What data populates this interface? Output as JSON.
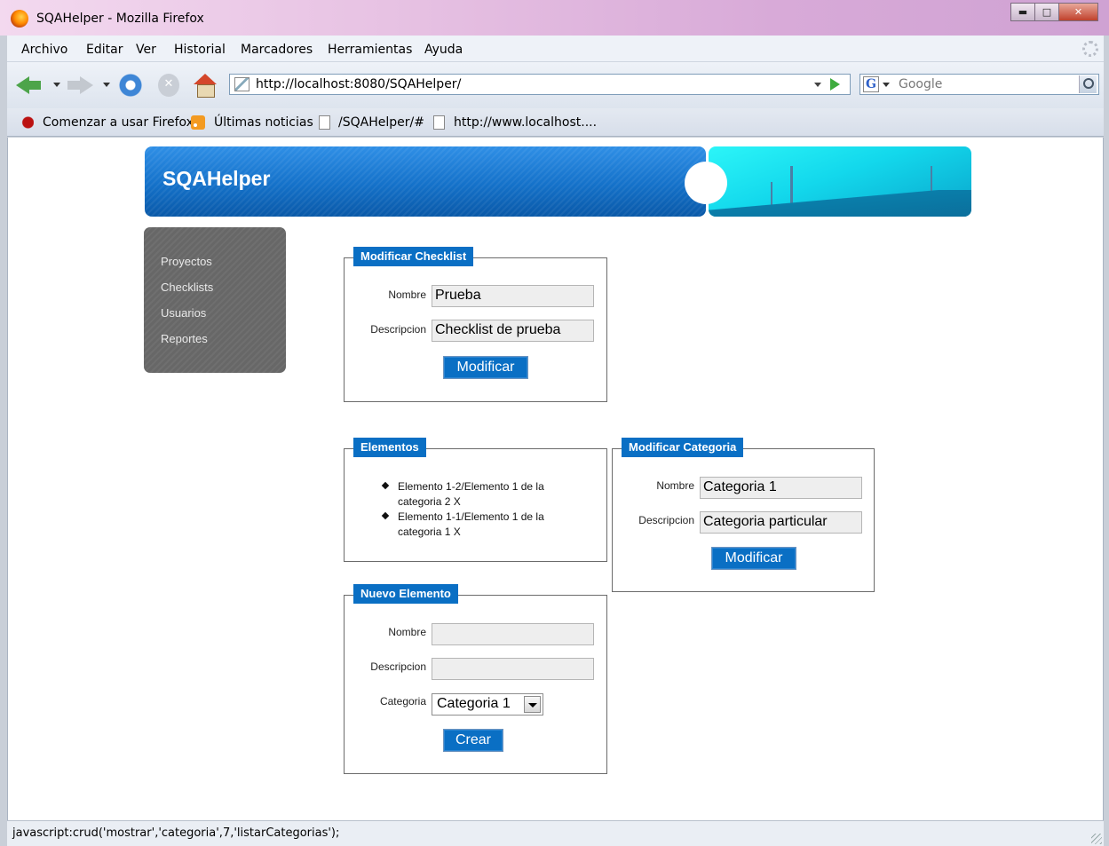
{
  "window": {
    "title": "SQAHelper - Mozilla Firefox",
    "controls": [
      "minimize-icon",
      "maximize-icon",
      "close-icon"
    ]
  },
  "menubar": {
    "items": [
      "Archivo",
      "Editar",
      "Ver",
      "Historial",
      "Marcadores",
      "Herramientas",
      "Ayuda"
    ]
  },
  "navbar": {
    "url": "http://localhost:8080/SQAHelper/",
    "search_placeholder": "Google"
  },
  "bookmarks": {
    "items": [
      "Comenzar a usar Firefox",
      "Últimas noticias",
      "/SQAHelper/#",
      "http://www.localhost...."
    ]
  },
  "page": {
    "brand": "SQAHelper",
    "sidebar": [
      "Proyectos",
      "Checklists",
      "Usuarios",
      "Reportes"
    ],
    "modificar_checklist": {
      "legend": "Modificar Checklist",
      "nombre_label": "Nombre",
      "nombre_value": "Prueba",
      "descripcion_label": "Descripcion",
      "descripcion_value": "Checklist de prueba",
      "button": "Modificar"
    },
    "elementos": {
      "legend": "Elementos",
      "items": [
        {
          "text": "Elemento 1-2/Elemento 1 de la categoria 2",
          "delete": "X"
        },
        {
          "text": "Elemento 1-1/Elemento 1 de la categoria 1",
          "delete": "X"
        }
      ]
    },
    "modificar_categoria": {
      "legend": "Modificar Categoria",
      "nombre_label": "Nombre",
      "nombre_value": "Categoria 1",
      "descripcion_label": "Descripcion",
      "descripcion_value": "Categoria particular",
      "button": "Modificar"
    },
    "nuevo_elemento": {
      "legend": "Nuevo Elemento",
      "nombre_label": "Nombre",
      "nombre_value": "",
      "descripcion_label": "Descripcion",
      "descripcion_value": "",
      "categoria_label": "Categoria",
      "categoria_value": "Categoria 1",
      "button": "Crear"
    }
  },
  "statusbar": {
    "text": "javascript:crud('mostrar','categoria',7,'listarCategorias');"
  }
}
